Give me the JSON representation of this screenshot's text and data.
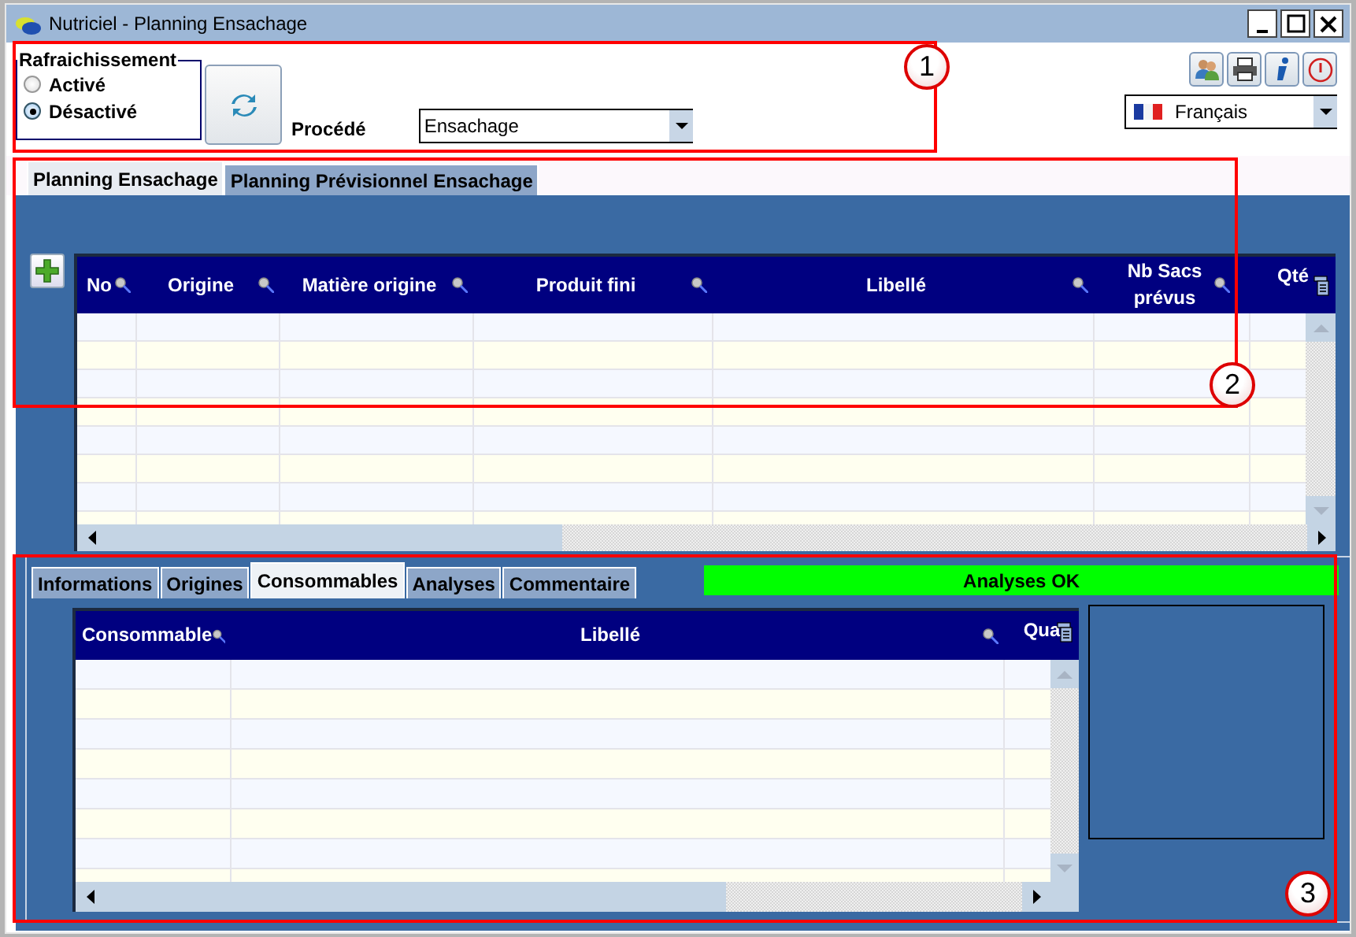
{
  "window": {
    "title": "Nutriciel - Planning Ensachage"
  },
  "refresh": {
    "legend": "Rafraichissement",
    "options": [
      {
        "label": "Activé",
        "selected": false
      },
      {
        "label": "Désactivé",
        "selected": true
      }
    ]
  },
  "process": {
    "label": "Procédé",
    "value": "Ensachage"
  },
  "language": {
    "value": "Français"
  },
  "planning_tabs": [
    {
      "label": "Planning Ensachage",
      "selected": true
    },
    {
      "label": "Planning Prévisionnel Ensachage",
      "selected": false
    }
  ],
  "planning_table": {
    "columns": [
      {
        "label": "No",
        "filter": true
      },
      {
        "label": "Origine",
        "filter": true
      },
      {
        "label": "Matière origine",
        "filter": true
      },
      {
        "label": "Produit fini",
        "filter": true
      },
      {
        "label": "Libellé",
        "filter": true
      },
      {
        "label": "Nb Sacs prévus",
        "filter": true
      },
      {
        "label": "Qté",
        "filter": false
      }
    ]
  },
  "detail_tabs": [
    {
      "label": "Informations",
      "selected": false
    },
    {
      "label": "Origines",
      "selected": false
    },
    {
      "label": "Consommables",
      "selected": true
    },
    {
      "label": "Analyses",
      "selected": false
    },
    {
      "label": "Commentaire",
      "selected": false
    }
  ],
  "status_banner": {
    "text": "Analyses OK"
  },
  "consumables_table": {
    "columns": [
      {
        "label": "Consommable",
        "filter": true
      },
      {
        "label": "Libellé",
        "filter": true
      },
      {
        "label": "Qua",
        "filter": false
      }
    ]
  },
  "annotations": [
    {
      "label": "1"
    },
    {
      "label": "2"
    },
    {
      "label": "3"
    }
  ]
}
